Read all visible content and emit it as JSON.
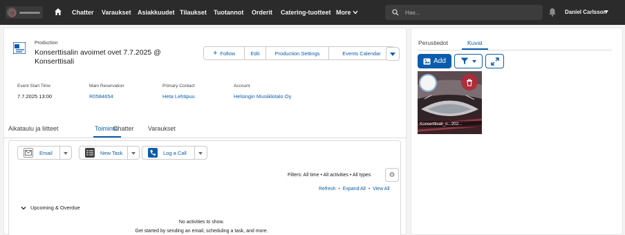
{
  "topbar": {
    "nav": [
      "Chatter",
      "Varaukset",
      "Asiakkuudet",
      "Tilaukset",
      "Tuotannot",
      "Orderit",
      "Catering-tuotteet",
      "More"
    ],
    "search_placeholder": "Hae...",
    "user": "Daniel Carlsson"
  },
  "record": {
    "type": "Production",
    "title": "Konserttisalin avoimet ovet 7.7.2025 @ Konserttisali",
    "actions": {
      "follow": "Follow",
      "edit": "Edit",
      "production_settings": "Production Settings",
      "events_calendar": "Events Calendar"
    },
    "highlights": [
      {
        "label": "Event Start Time",
        "value": "7.7.2025 13:00"
      },
      {
        "label": "Main Reservation",
        "value": "R0584654"
      },
      {
        "label": "Primary Contact",
        "value": "Heta Lehtipuu"
      },
      {
        "label": "Account",
        "value": "Helsingin Musiikkitalo Oy"
      }
    ]
  },
  "tabs": [
    "Aikataulu ja liitteet",
    "Toiminta",
    "Chatter",
    "Varaukset"
  ],
  "activity": {
    "email": "Email",
    "new_task": "New Task",
    "log_a_call": "Log a Call",
    "filters": "Filters: All time • All activities • All types",
    "refresh": "Refresh",
    "expand_all": "Expand All",
    "view_all": "View All",
    "section": "Upcoming & Overdue",
    "empty_title": "No activities to show.",
    "empty_sub": "Get started by sending an email, scheduling a task, and more."
  },
  "side": {
    "tabs": [
      "Perustiedot",
      "Kuvat"
    ],
    "add": "Add",
    "file_caption": "Konserttisali_o...202..."
  },
  "colors": {
    "brand": "#0b5cab",
    "topbar": "#2b2b2b"
  }
}
